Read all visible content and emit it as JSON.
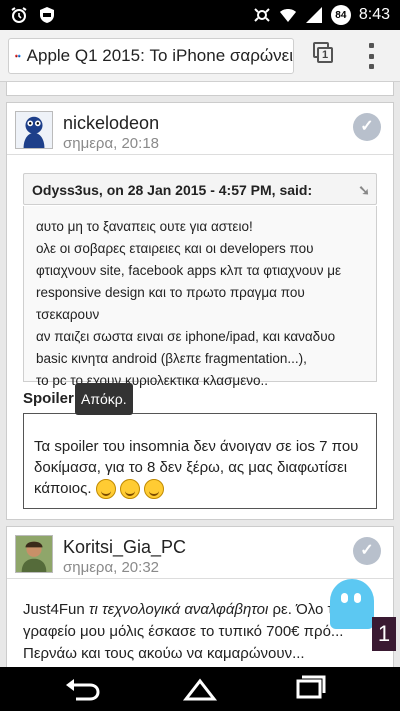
{
  "status": {
    "time": "8:43",
    "battery": "84"
  },
  "browser": {
    "url": "Apple Q1 2015: Το iPhone σαρώνει",
    "tab_count": "1"
  },
  "post1": {
    "author": "nickelodeon",
    "date": "σημερα, 20:18",
    "quote_header": "Odyss3us, on 28 Jan 2015 - 4:57 PM, said:",
    "quote_lines": [
      "αυτο μη το ξαναπεις ουτε για αστειο!",
      "ολε οι σοβαρες εταιρειες και οι developers  που",
      "φτιαχνουν site, facebook apps κλπ τα φτιαχνουν με",
      "responsive design και το πρωτο πραγμα που τσεκαρουν",
      "αν παιζει σωστα ειναι σε iphone/ipad, και καναδυο",
      "basic κινητα android (βλεπε fragmentation...),",
      "το pc το εχουν κυριολεκτικα κλασμενο.."
    ],
    "spoiler_label": "Spoiler",
    "spoiler_button": "Απόκρ.",
    "spoiler_text": "Τα spoiler του insomnia δεν άνοιγαν σε ios 7 που δοκίμασα, για το 8 δεν ξέρω, ας μας διαφωτίσει κάποιος."
  },
  "post2": {
    "author": "Koritsi_Gia_PC",
    "date": "σημερα, 20:32",
    "line1_a": "Just4Fun ",
    "line1_em": "τι τεχνολογικά αναλφάβητοι",
    "line1_b": " ρε. Όλο το",
    "line2": "γραφείο μου μόλις έσκασε το τυπικό 700€ πρό...",
    "line3": "Περνάω και τους ακούω να καμαρώνουν..."
  },
  "ghostery": {
    "count": "1"
  },
  "colors": {
    "ghost": "#5cc8f2",
    "check": "#b8c0cc",
    "spoiler_btn": "#333333"
  }
}
